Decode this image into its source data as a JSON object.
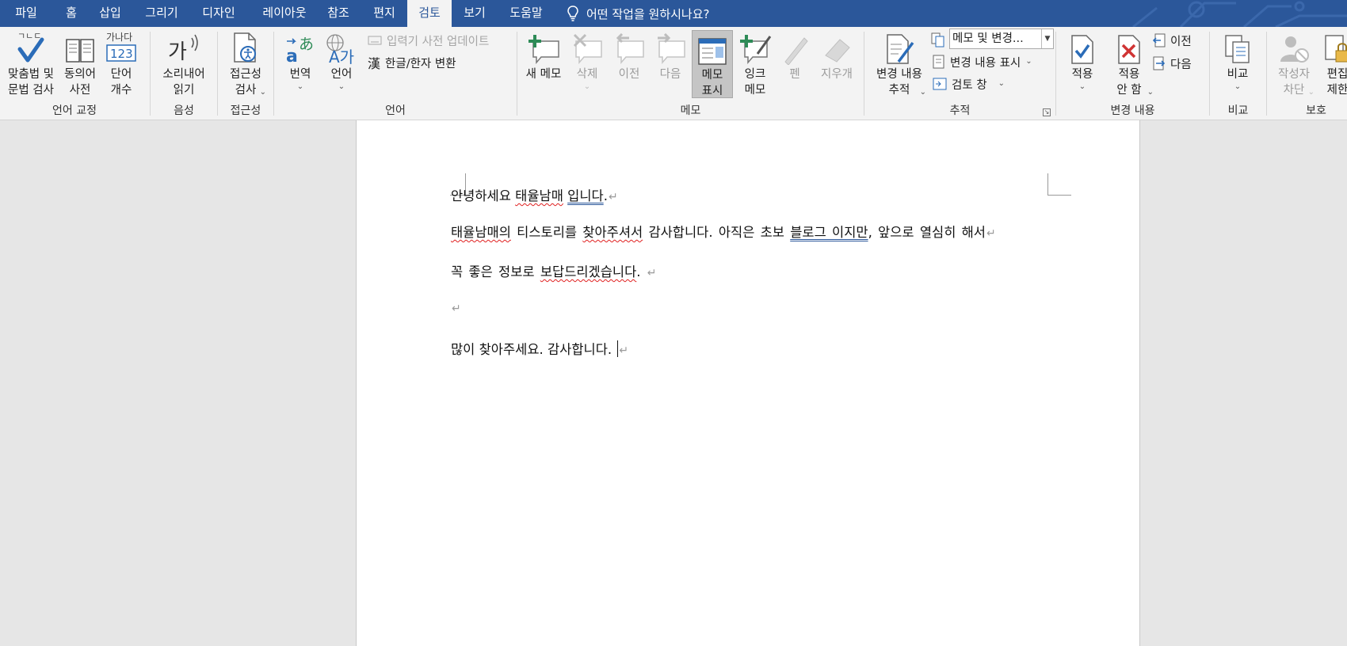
{
  "tabs": [
    "파일",
    "홈",
    "삽입",
    "그리기",
    "디자인",
    "레이아웃",
    "참조",
    "편지",
    "검토",
    "보기",
    "도움말"
  ],
  "active_tab": "검토",
  "tell_me": "어떤 작업을 원하시나요?",
  "groups": {
    "proofing": {
      "label": "언어 교정",
      "spelling": "맞춤법 및\n문법 검사",
      "thesaurus": "동의어\n사전",
      "word_count": "단어\n개수",
      "word_count_icon_text": "가나다",
      "word_count_icon_num": "123",
      "spelling_icon_text": "ㄱㄴㄷ"
    },
    "speech": {
      "label": "음성",
      "read_aloud": "소리내어\n읽기",
      "read_aloud_icon_text": "가"
    },
    "accessibility": {
      "label": "접근성",
      "check": "접근성\n검사"
    },
    "language": {
      "label": "언어",
      "translate": "번역",
      "language": "언어",
      "ime_update": "입력기 사전 업데이트",
      "hanja": "한글/한자 변환",
      "hanja_icon": "漢",
      "translate_icon_a": "a",
      "translate_icon_b": "あ",
      "language_icon": "A가"
    },
    "comments": {
      "label": "메모",
      "new": "새 메모",
      "delete": "삭제",
      "prev": "이전",
      "next": "다음",
      "show": "메모\n표시",
      "ink": "잉크\n메모",
      "pen": "펜",
      "eraser": "지우개"
    },
    "tracking": {
      "label": "추적",
      "track_changes": "변경 내용\n추적",
      "markup_combo": "메모 및 변경...",
      "show_markup": "변경 내용 표시",
      "review_pane": "검토 창"
    },
    "changes": {
      "label": "변경 내용",
      "accept": "적용",
      "reject": "적용\n안 함",
      "prev": "이전",
      "next": "다음"
    },
    "compare": {
      "label": "비교",
      "compare": "비교"
    },
    "protect": {
      "label": "보호",
      "block_authors": "작성자\n차단",
      "restrict_editing": "편집\n제한"
    }
  },
  "document": {
    "line1": {
      "a": "안녕하세요 ",
      "b": "태율남매",
      "c": " ",
      "d": "입니다",
      "e": "."
    },
    "line2": {
      "a": "태율남매의",
      "b": " 티스토리를 ",
      "c": "찾아주셔서",
      "d": " 감사합니다. 아직은 초보 ",
      "e": "블로그 이지만",
      "f": ", 앞으로 열심히 해서"
    },
    "line3": {
      "a": "꼭 좋은 정보로 ",
      "b": "보답드리겠습니다",
      "c": ". "
    },
    "line5": "많이 찾아주세요. 감사합니다. ",
    "para_mark": "↵"
  }
}
